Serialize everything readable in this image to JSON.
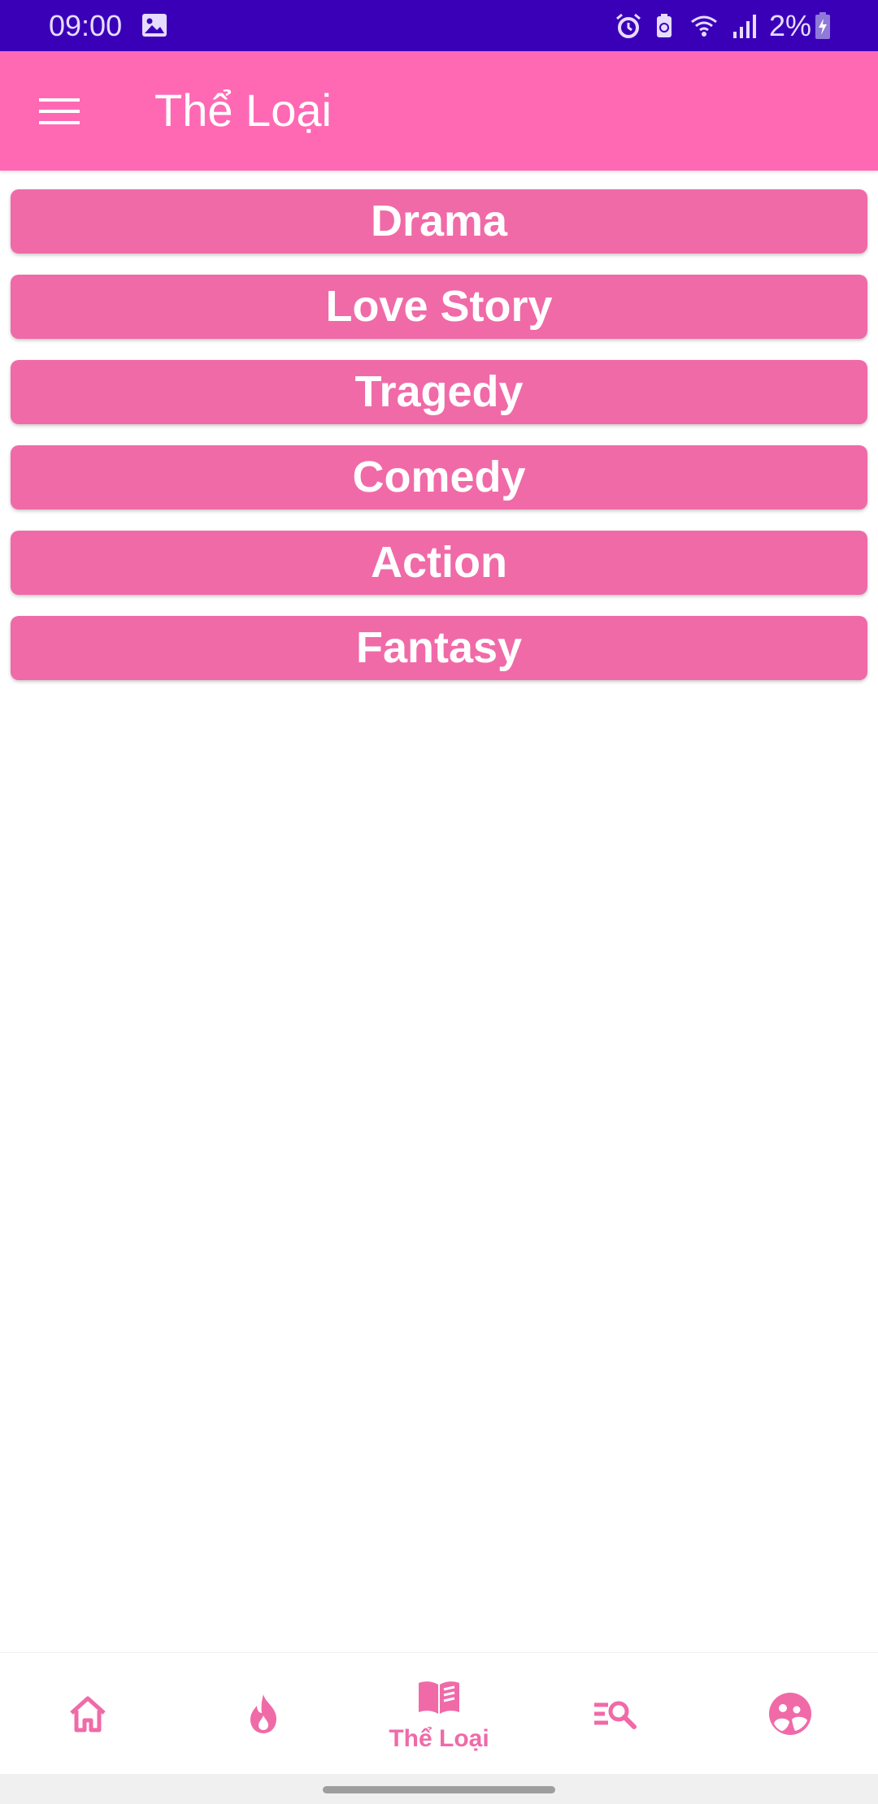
{
  "status_bar": {
    "time": "09:00",
    "battery": "2%",
    "icons": [
      "gallery-icon",
      "alarm-icon",
      "battery-saver-icon",
      "wifi-icon",
      "signal-icon",
      "battery-charging-icon"
    ]
  },
  "app_bar": {
    "title": "Thể Loại",
    "menu_icon": "hamburger-menu-icon"
  },
  "genres": [
    "Drama",
    "Love Story",
    "Tragedy",
    "Comedy",
    "Action",
    "Fantasy"
  ],
  "bottom_nav": {
    "items": [
      {
        "icon": "home-icon",
        "label": ""
      },
      {
        "icon": "flame-icon",
        "label": ""
      },
      {
        "icon": "book-icon",
        "label": "Thể Loại",
        "selected": true
      },
      {
        "icon": "list-search-icon",
        "label": ""
      },
      {
        "icon": "profile-icon",
        "label": ""
      }
    ]
  },
  "colors": {
    "status_bar": "#3a00b8",
    "app_bar": "#ff69b4",
    "genre_button": "#f06aa8",
    "nav_accent": "#f06aa8"
  }
}
